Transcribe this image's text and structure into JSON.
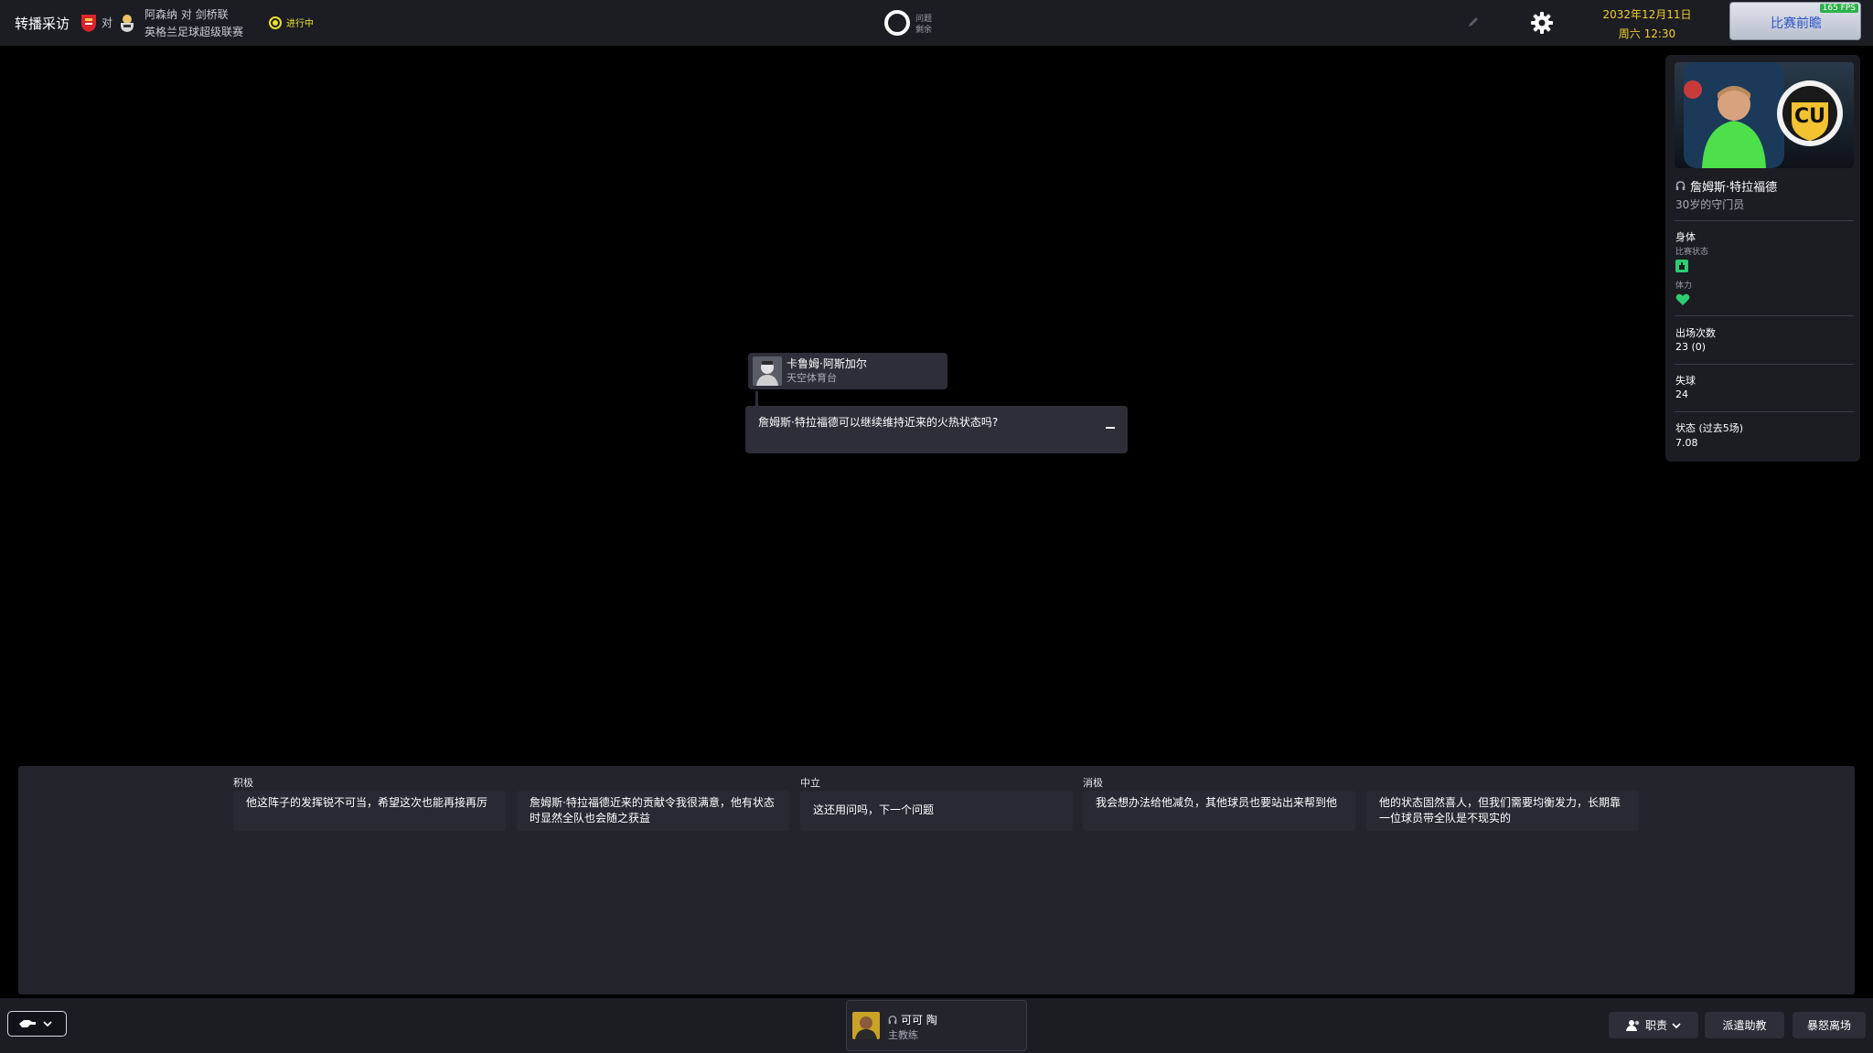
{
  "header": {
    "screen_title": "转播采访",
    "vs_small": "对",
    "match_teams": "阿森纳 对 剑桥联",
    "competition": "英格兰足球超级联赛",
    "live_status": "进行中",
    "questions_label_line1": "问题",
    "questions_label_line2": "剩余",
    "date": "2032年12月11日",
    "time": "周六 12:30",
    "continue_label": "比赛前瞻",
    "fps": "165 FPS"
  },
  "player_card": {
    "name": "詹姆斯·特拉福德",
    "description": "30岁的守门员",
    "physical_heading": "身体",
    "match_condition_label": "比赛状态",
    "stamina_label": "体力",
    "appearances_label": "出场次数",
    "appearances_value": "23 (0)",
    "conceded_label": "失球",
    "conceded_value": "24",
    "form_label": "状态 (过去5场)",
    "form_value": "7.08"
  },
  "interview": {
    "journalist_name": "卡鲁姆·阿斯加尔",
    "journalist_outlet": "天空体育台",
    "question": "詹姆斯·特拉福德可以继续维持近来的火热状态吗?"
  },
  "responses": {
    "tone_positive": "积极",
    "tone_neutral": "中立",
    "tone_negative": "消极",
    "options": [
      {
        "tone": "positive",
        "text": "他这阵子的发挥锐不可当，希望这次也能再接再厉"
      },
      {
        "tone": "positive",
        "text": "詹姆斯·特拉福德近来的贡献令我很满意，他有状态时显然全队也会随之获益"
      },
      {
        "tone": "neutral",
        "text": "这还用问吗，下一个问题"
      },
      {
        "tone": "negative",
        "text": "我会想办法给他减负，其他球员也要站出来帮到他"
      },
      {
        "tone": "negative",
        "text": "他的状态固然喜人，但我们需要均衡发力，长期靠一位球员带全队是不现实的"
      }
    ]
  },
  "bottom": {
    "manager_name": "可可 陶",
    "manager_role": "主教练",
    "responsibilities_label": "职责",
    "send_assistant_label": "派遣助教",
    "storm_off_label": "暴怒离场"
  },
  "colors": {
    "accent_yellow": "#f2cf2e",
    "status_green": "#2ecc71",
    "continue_text": "#2d55c8",
    "panel_bg": "#23242c"
  },
  "icons": [
    "gear-icon",
    "pencil-icon",
    "headset-icon",
    "chevron-down-icon",
    "heart-icon",
    "condition-icon",
    "live-icon",
    "gesture-icon",
    "people-icon"
  ]
}
